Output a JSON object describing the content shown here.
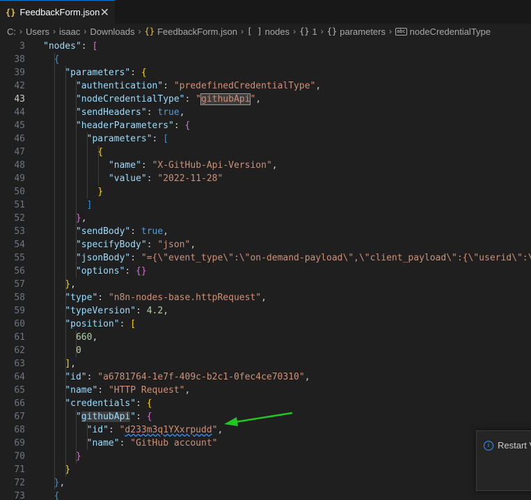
{
  "tab": {
    "icon": "{}",
    "title": "FeedbackForm.json",
    "close": "✕"
  },
  "breadcrumb": {
    "items": [
      {
        "icon": "",
        "label": "C:"
      },
      {
        "icon": "",
        "label": "Users"
      },
      {
        "icon": "",
        "label": "isaac"
      },
      {
        "icon": "",
        "label": "Downloads"
      },
      {
        "icon": "{}",
        "label": "FeedbackForm.json"
      },
      {
        "icon": "[ ]",
        "label": "nodes"
      },
      {
        "icon": "{}",
        "label": "1"
      },
      {
        "icon": "{}",
        "label": "parameters"
      },
      {
        "icon": "abc",
        "label": "nodeCredentialType"
      }
    ]
  },
  "lines": [
    {
      "n": "3",
      "parts": [
        [
          "k",
          "\"nodes\""
        ],
        [
          "p",
          ": "
        ],
        [
          "b1",
          "["
        ]
      ],
      "indent": 0
    },
    {
      "n": "38",
      "parts": [
        [
          "b2",
          "{"
        ]
      ],
      "indent": 1
    },
    {
      "n": "39",
      "parts": [
        [
          "k",
          "\"parameters\""
        ],
        [
          "p",
          ": "
        ],
        [
          "b3",
          "{"
        ]
      ],
      "indent": 2
    },
    {
      "n": "42",
      "parts": [
        [
          "k",
          "\"authentication\""
        ],
        [
          "p",
          ": "
        ],
        [
          "s",
          "\"predefinedCredentialType\""
        ],
        [
          "p",
          ","
        ]
      ],
      "indent": 3
    },
    {
      "n": "43",
      "parts": [
        [
          "k",
          "\"nodeCredentialType\""
        ],
        [
          "p",
          ": "
        ],
        [
          "s",
          "\""
        ],
        [
          "shl",
          "githubApi"
        ],
        [
          "s",
          "\""
        ],
        [
          "p",
          ","
        ]
      ],
      "indent": 3,
      "active": true
    },
    {
      "n": "44",
      "parts": [
        [
          "k",
          "\"sendHeaders\""
        ],
        [
          "p",
          ": "
        ],
        [
          "kw",
          "true"
        ],
        [
          "p",
          ","
        ]
      ],
      "indent": 3
    },
    {
      "n": "45",
      "parts": [
        [
          "k",
          "\"headerParameters\""
        ],
        [
          "p",
          ": "
        ],
        [
          "b1",
          "{"
        ]
      ],
      "indent": 3
    },
    {
      "n": "46",
      "parts": [
        [
          "k",
          "\"parameters\""
        ],
        [
          "p",
          ": "
        ],
        [
          "b2",
          "["
        ]
      ],
      "indent": 4
    },
    {
      "n": "47",
      "parts": [
        [
          "b3",
          "{"
        ]
      ],
      "indent": 5
    },
    {
      "n": "48",
      "parts": [
        [
          "k",
          "\"name\""
        ],
        [
          "p",
          ": "
        ],
        [
          "s",
          "\"X-GitHub-Api-Version\""
        ],
        [
          "p",
          ","
        ]
      ],
      "indent": 6
    },
    {
      "n": "49",
      "parts": [
        [
          "k",
          "\"value\""
        ],
        [
          "p",
          ": "
        ],
        [
          "s",
          "\"2022-11-28\""
        ]
      ],
      "indent": 6
    },
    {
      "n": "50",
      "parts": [
        [
          "b3",
          "}"
        ]
      ],
      "indent": 5
    },
    {
      "n": "51",
      "parts": [
        [
          "b2",
          "]"
        ]
      ],
      "indent": 4
    },
    {
      "n": "52",
      "parts": [
        [
          "b1",
          "}"
        ],
        [
          "p",
          ","
        ]
      ],
      "indent": 3
    },
    {
      "n": "53",
      "parts": [
        [
          "k",
          "\"sendBody\""
        ],
        [
          "p",
          ": "
        ],
        [
          "kw",
          "true"
        ],
        [
          "p",
          ","
        ]
      ],
      "indent": 3
    },
    {
      "n": "54",
      "parts": [
        [
          "k",
          "\"specifyBody\""
        ],
        [
          "p",
          ": "
        ],
        [
          "s",
          "\"json\""
        ],
        [
          "p",
          ","
        ]
      ],
      "indent": 3
    },
    {
      "n": "55",
      "parts": [
        [
          "k",
          "\"jsonBody\""
        ],
        [
          "p",
          ": "
        ],
        [
          "s",
          "\"={\\\"event_type\\\":\\\"on-demand-payload\\\",\\\"client_payload\\\":{\\\"userid\\\":\\\""
        ]
      ],
      "indent": 3
    },
    {
      "n": "56",
      "parts": [
        [
          "k",
          "\"options\""
        ],
        [
          "p",
          ": "
        ],
        [
          "b1",
          "{}"
        ]
      ],
      "indent": 3
    },
    {
      "n": "57",
      "parts": [
        [
          "b3",
          "}"
        ],
        [
          "p",
          ","
        ]
      ],
      "indent": 2
    },
    {
      "n": "58",
      "parts": [
        [
          "k",
          "\"type\""
        ],
        [
          "p",
          ": "
        ],
        [
          "s",
          "\"n8n-nodes-base.httpRequest\""
        ],
        [
          "p",
          ","
        ]
      ],
      "indent": 2
    },
    {
      "n": "59",
      "parts": [
        [
          "k",
          "\"typeVersion\""
        ],
        [
          "p",
          ": "
        ],
        [
          "n",
          "4.2"
        ],
        [
          "p",
          ","
        ]
      ],
      "indent": 2
    },
    {
      "n": "60",
      "parts": [
        [
          "k",
          "\"position\""
        ],
        [
          "p",
          ": "
        ],
        [
          "b3",
          "["
        ]
      ],
      "indent": 2
    },
    {
      "n": "61",
      "parts": [
        [
          "n",
          "660"
        ],
        [
          "p",
          ","
        ]
      ],
      "indent": 3
    },
    {
      "n": "62",
      "parts": [
        [
          "n",
          "0"
        ]
      ],
      "indent": 3
    },
    {
      "n": "63",
      "parts": [
        [
          "b3",
          "]"
        ],
        [
          "p",
          ","
        ]
      ],
      "indent": 2
    },
    {
      "n": "64",
      "parts": [
        [
          "k",
          "\"id\""
        ],
        [
          "p",
          ": "
        ],
        [
          "s",
          "\"a6781764-1e7f-409c-b2c1-0fec4ce70310\""
        ],
        [
          "p",
          ","
        ]
      ],
      "indent": 2
    },
    {
      "n": "65",
      "parts": [
        [
          "k",
          "\"name\""
        ],
        [
          "p",
          ": "
        ],
        [
          "s",
          "\"HTTP Request\""
        ],
        [
          "p",
          ","
        ]
      ],
      "indent": 2
    },
    {
      "n": "66",
      "parts": [
        [
          "k",
          "\"credentials\""
        ],
        [
          "p",
          ": "
        ],
        [
          "b3",
          "{"
        ]
      ],
      "indent": 2
    },
    {
      "n": "67",
      "parts": [
        [
          "k",
          "\""
        ],
        [
          "khl",
          "githubApi"
        ],
        [
          "k",
          "\""
        ],
        [
          "p",
          ": "
        ],
        [
          "b1",
          "{"
        ]
      ],
      "indent": 3
    },
    {
      "n": "68",
      "parts": [
        [
          "k",
          "\"id\""
        ],
        [
          "p",
          ": "
        ],
        [
          "s",
          "\""
        ],
        [
          "sq",
          "d233m3q1YXxrpudd"
        ],
        [
          "s",
          "\""
        ],
        [
          "p",
          ","
        ]
      ],
      "indent": 4
    },
    {
      "n": "69",
      "parts": [
        [
          "k",
          "\"name\""
        ],
        [
          "p",
          ": "
        ],
        [
          "s",
          "\"GitHub account\""
        ]
      ],
      "indent": 4
    },
    {
      "n": "70",
      "parts": [
        [
          "b1",
          "}"
        ]
      ],
      "indent": 3
    },
    {
      "n": "71",
      "parts": [
        [
          "b3",
          "}"
        ]
      ],
      "indent": 2
    },
    {
      "n": "72",
      "parts": [
        [
          "b2",
          "}"
        ],
        [
          "p",
          ","
        ]
      ],
      "indent": 1
    },
    {
      "n": "73",
      "parts": [
        [
          "b2",
          "{"
        ]
      ],
      "indent": 1
    }
  ],
  "notification": {
    "icon": "info-icon",
    "text": "Restart V"
  },
  "colors": {
    "accent": "#0078d4",
    "arrow": "#22c522"
  }
}
